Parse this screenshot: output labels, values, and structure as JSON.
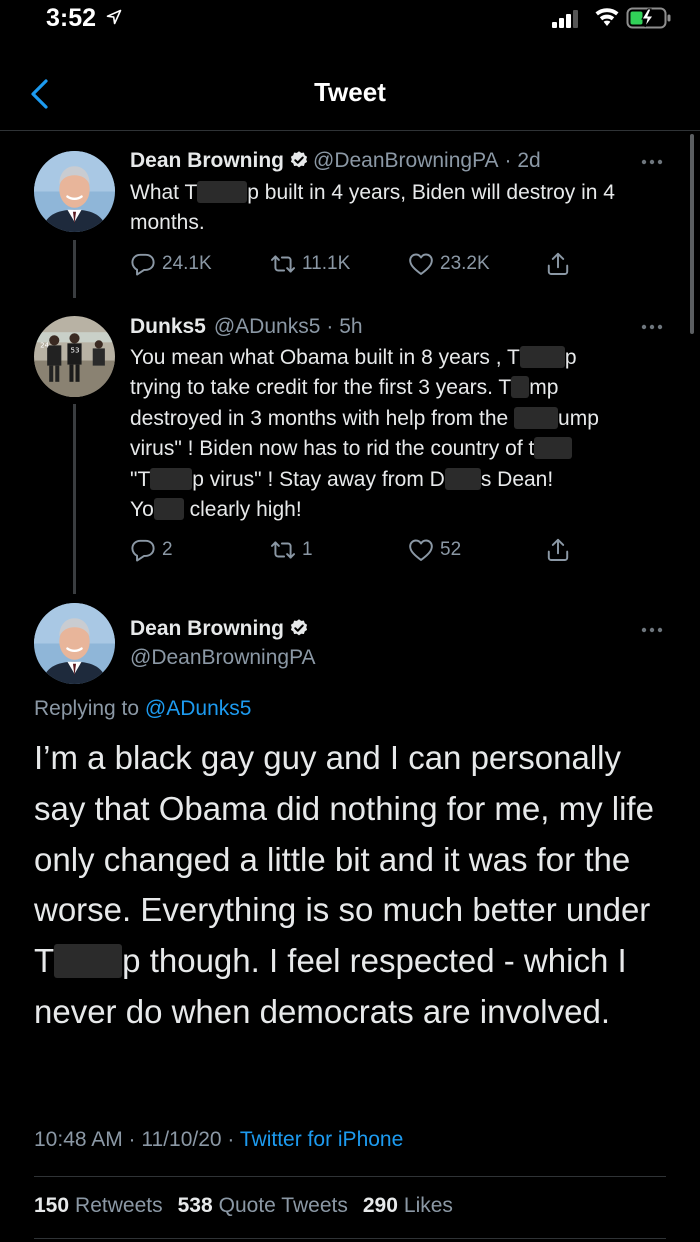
{
  "status": {
    "time": "3:52"
  },
  "nav": {
    "title": "Tweet"
  },
  "tweet1": {
    "name": "Dean Browning",
    "handle": "@DeanBrowningPA",
    "time": "· 2d",
    "text_a": "What T",
    "text_b": "p built in 4 years, Biden will destroy in 4 months.",
    "replies": "24.1K",
    "retweets": "11.1K",
    "likes": "23.2K"
  },
  "tweet2": {
    "name": "Dunks5",
    "handle": "@ADunks5",
    "time": "· 5h",
    "l1a": "You mean what Obama built in 8 years , T",
    "l1b": "p",
    "l2a": "trying to take credit for the first 3 years. T",
    "l2b": "mp",
    "l3a": "destroyed in 3 months with help from the",
    "l3b": "ump",
    "l4a": "virus\" ! Biden now has to rid the country of t",
    "l5a": "\"T",
    "l5b": "p virus\" ! Stay away from D",
    "l5c": "s Dean!",
    "l6a": "Yo",
    "l6b": "clearly high!",
    "replies": "2",
    "retweets": "1",
    "likes": "52"
  },
  "main_tweet": {
    "name": "Dean Browning",
    "handle": "@DeanBrowningPA",
    "replying_label": "Replying to",
    "replying_to": "@ADunks5",
    "text_a": "I’m a black gay guy and I can personally say that Obama did nothing for me, my life only changed a little bit and it was for the worse. Everything is so much better under T",
    "text_b": "p though. I feel respected - which I never do when democrats are involved.",
    "timestamp": "10:48 AM · 11/10/20 ·",
    "source": "Twitter for iPhone",
    "retweets_count": "150",
    "retweets_label": "Retweets",
    "quotes_count": "538",
    "quotes_label": "Quote Tweets",
    "likes_count": "290",
    "likes_label": "Likes"
  },
  "icons": {
    "back": "chevron-left-icon",
    "verified": "verified-badge-icon",
    "reply": "reply-icon",
    "retweet": "retweet-icon",
    "like": "heart-icon",
    "share": "share-icon",
    "more": "more-dots-icon"
  },
  "colors": {
    "background": "#000000",
    "accent": "#1d9bf0",
    "text": "#e7e9ea",
    "muted": "#8b98a5"
  }
}
